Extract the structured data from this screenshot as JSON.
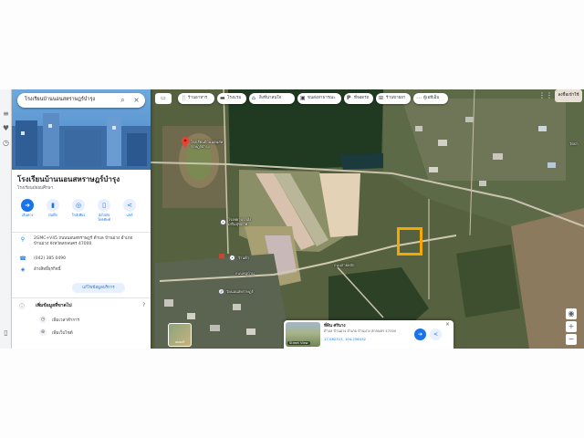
{
  "search": {
    "value": "โรงเรียนบ้านนอนสหราษฎร์บำรุง",
    "search_icon": "search-icon",
    "close_icon": "close-icon"
  },
  "place": {
    "title": "โรงเรียนบ้านนอนสหราษฎร์บำรุง",
    "subtitle": "โรงเรียนมัธยมศึกษา",
    "actions": [
      {
        "label": "เส้นทาง",
        "icon": "directions-icon"
      },
      {
        "label": "บันทึก",
        "icon": "bookmark-icon"
      },
      {
        "label": "ใกล้เคียง",
        "icon": "nearby-icon"
      },
      {
        "label": "ส่งไปยังโทรศัพท์",
        "icon": "phone-send-icon"
      },
      {
        "label": "แชร์",
        "icon": "share-icon"
      }
    ],
    "address": "2GMC+V45 ถนนนอนสหราษฎร์ ตำบล บ้านม่วง อำเภอ บ้านม่วง จังหวัดสกลนคร 47000",
    "phone": "(042) 385 0490",
    "claim": "อ้างสิทธิ์ธุรกิจนี้",
    "claim_button": "แก้ไขข้อมูลบริการ",
    "section_title": "เพิ่มข้อมูลที่ขาดไป",
    "section_items": [
      "เพิ่มเวลาทำการ",
      "เพิ่มเว็บไซต์"
    ]
  },
  "chips": [
    {
      "label": "ร้านอาหาร",
      "icon": "restaurant-icon"
    },
    {
      "label": "โรงแรม",
      "icon": "hotel-icon"
    },
    {
      "label": "สิ่งที่น่าสนใจ",
      "icon": "attraction-icon"
    },
    {
      "label": "ขนส่งสาธารณะ",
      "icon": "transit-icon"
    },
    {
      "label": "ที่จอดรถ",
      "icon": "parking-icon"
    },
    {
      "label": "ร้านขายยา",
      "icon": "pharmacy-icon"
    },
    {
      "label": "ตู้เอทีเอ็ม",
      "icon": "more-icon"
    }
  ],
  "map_labels": {
    "school_top": "โรงเรียนบ้านนอนสหราษฎร์บำรุง",
    "poi_mid": "โรงพยาบาลส่งเสริมสุขภาพ",
    "poi_low": "ร้านค้า",
    "temple": "วัดนอนสหราษฎร์",
    "road_a": "ถนนสายหลัก",
    "road_b": "ถนนหมู่บ้าน",
    "right_label": "วัดป่า"
  },
  "layers": {
    "label": "เลเยอร์"
  },
  "card": {
    "title": "ที่ดิน ศรีนาง",
    "address": "ตำบล บ้านม่วง อำเภอ บ้านม่วง สกลนคร 47000",
    "coordinates": "17.082313, 104.256432",
    "streetview": "Street View"
  },
  "account": {
    "label": "ลงชื่อเข้าใช้"
  },
  "colors": {
    "accent": "#1a73e8",
    "highlight": "#f6a800",
    "pin": "#ea4335"
  }
}
